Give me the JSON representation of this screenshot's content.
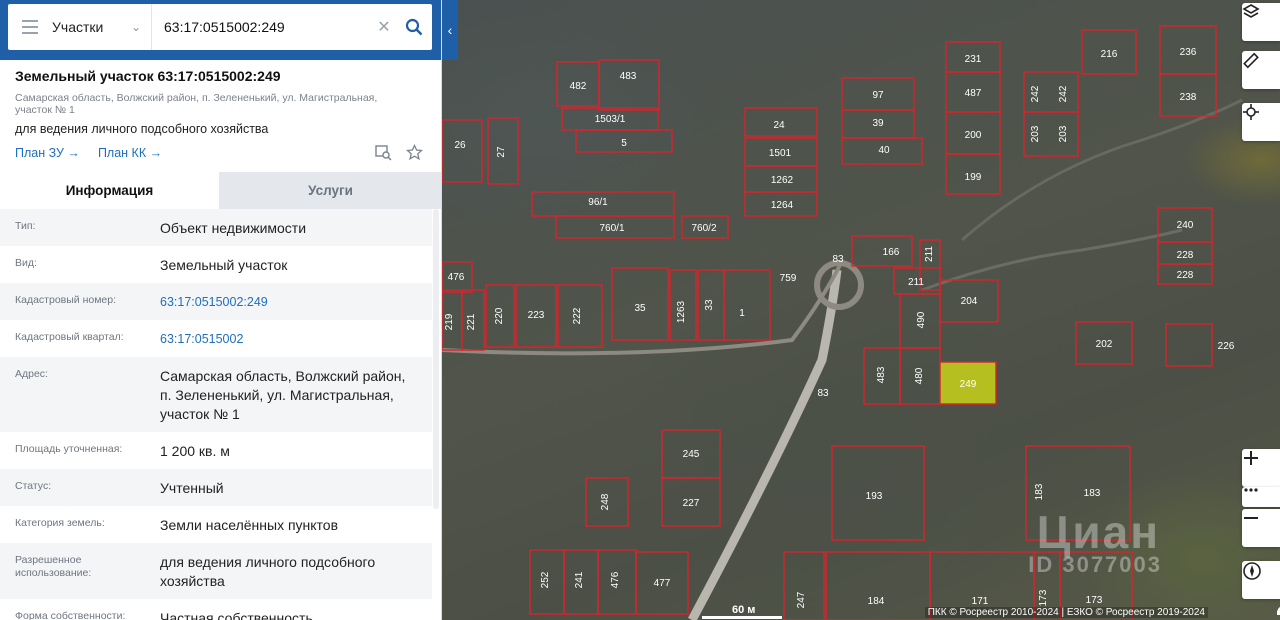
{
  "search": {
    "category": "Участки",
    "query": "63:17:0515002:249"
  },
  "object": {
    "title": "Земельный участок 63:17:0515002:249",
    "address_line": "Самарская область, Волжский район, п. Зелененький, ул. Магистральная, участок № 1",
    "purpose": "для ведения личного подсобного хозяйства",
    "link_plan_zu": "План ЗУ →",
    "link_plan_kk": "План КК →"
  },
  "tabs": [
    {
      "label": "Информация",
      "active": true
    },
    {
      "label": "Услуги",
      "active": false
    }
  ],
  "info": [
    {
      "key": "Тип:",
      "value": "Объект недвижимости",
      "link": false
    },
    {
      "key": "Вид:",
      "value": "Земельный участок",
      "link": false
    },
    {
      "key": "Кадастровый номер:",
      "value": "63:17:0515002:249",
      "link": true
    },
    {
      "key": "Кадастровый квартал:",
      "value": "63:17:0515002",
      "link": true
    },
    {
      "key": "Адрес:",
      "value": "Самарская область, Волжский район, п. Зелененький, ул. Магистральная, участок № 1",
      "link": false
    },
    {
      "key": "Площадь уточненная:",
      "value": "1 200 кв. м",
      "link": false
    },
    {
      "key": "Статус:",
      "value": "Учтенный",
      "link": false
    },
    {
      "key": "Категория земель:",
      "value": "Земли населённых пунктов",
      "link": false
    },
    {
      "key": "Разрешенное использование:",
      "value": "для ведения личного подсобного хозяйства",
      "link": false
    },
    {
      "key": "Форма собственности:",
      "value": "Частная собственность",
      "link": false
    }
  ],
  "map": {
    "scale_label": "60 м",
    "attribution": "ПКК © Росреестр 2010-2024 | ЕЗКО © Росреестр 2019-2024",
    "watermark": "Циан",
    "watermark_id": "ID 3077003",
    "parcel_labels": [
      "231",
      "216",
      "236",
      "482",
      "483",
      "97",
      "487",
      "242",
      "242",
      "238",
      "1503/1",
      "24",
      "39",
      "200",
      "203",
      "203",
      "26",
      "27",
      "5",
      "1501",
      "40",
      "240",
      "1262",
      "199",
      "96/1",
      "1264",
      "228",
      "760/1",
      "760/2",
      "166",
      "211",
      "228",
      "476",
      "83",
      "759",
      "211",
      "204",
      "219",
      "221",
      "220",
      "223",
      "222",
      "35",
      "1263",
      "33",
      "1",
      "490",
      "202",
      "226",
      "483",
      "480",
      "249",
      "83",
      "245",
      "248",
      "227",
      "193",
      "183",
      "183",
      "252",
      "241",
      "476",
      "477",
      "247",
      "184",
      "171",
      "173",
      "173"
    ],
    "selected_parcel": "249"
  },
  "colors": {
    "header_blue": "#1f5fa8",
    "link_blue": "#1f6fbf",
    "parcel_red": "#d9232b",
    "selected_fill": "#c9d21a"
  }
}
